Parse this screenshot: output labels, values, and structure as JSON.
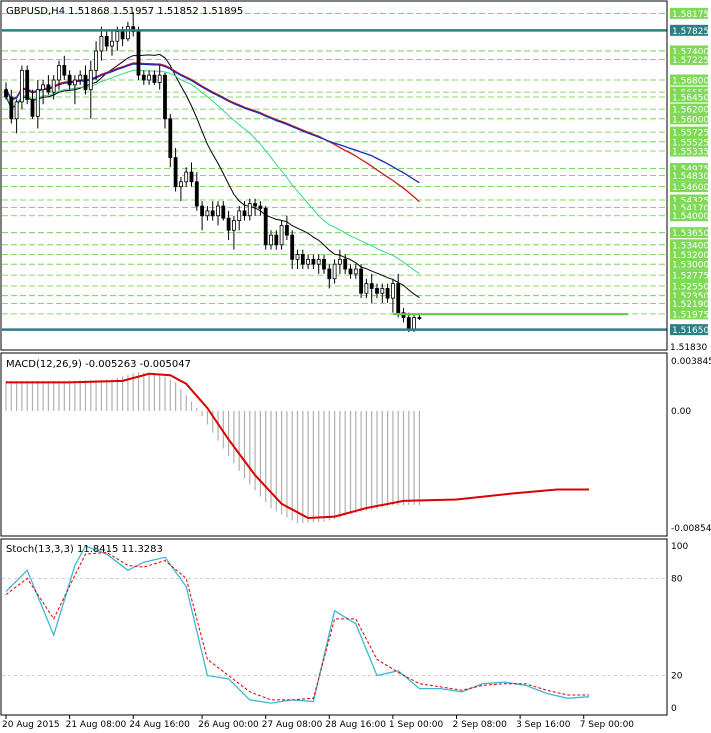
{
  "colors": {
    "background": "#ffffff",
    "frame": "#000000",
    "grid": "#c0c0c0",
    "bull_body": "#ffffff",
    "bear_body": "#000000",
    "candle_outline": "#000000",
    "support_line": "#2a7f85",
    "level_line": "#5ccc3a",
    "label_bg": "#7ed957",
    "ma_fast": "#000000",
    "ma_medium": "#39d883",
    "ma_slow_red": "#c81818",
    "ma_slow_blue": "#1a2ab8",
    "macd_hist": "#b0b0b0",
    "macd_signal": "#dd0000",
    "stoch_main": "#3fb6d8",
    "stoch_signal": "#dd0000"
  },
  "chart_data": [
    {
      "type": "candlestick",
      "title": "GBPUSD,H4",
      "ohlc_header": "1.51868 1.51957 1.51852 1.51895",
      "ylim": [
        1.5123,
        1.5843
      ],
      "y_ticks": [
        "1.58175",
        "1.57825",
        "1.57400",
        "1.57225",
        "1.56800",
        "1.56550",
        "1.56450",
        "1.56200",
        "1.56000",
        "1.55725",
        "1.55525",
        "1.55335",
        "1.54975",
        "1.54830",
        "1.54600",
        "1.54325",
        "1.54170",
        "1.54000",
        "1.53650",
        "1.53400",
        "1.53200",
        "1.53000",
        "1.52775",
        "1.52550",
        "1.52350",
        "1.52190",
        "1.51975",
        "1.51650"
      ],
      "levels_sorted": [
        1.58175,
        1.57825,
        1.574,
        1.57225,
        1.568,
        1.5655,
        1.5645,
        1.562,
        1.56,
        1.55725,
        1.55525,
        1.55335,
        1.54975,
        1.5483,
        1.546,
        1.54325,
        1.5417,
        1.54,
        1.5365,
        1.534,
        1.532,
        1.53,
        1.52775,
        1.5255,
        1.5235,
        1.5219,
        1.51975,
        1.5165
      ],
      "highlighted_levels": [
        "1.57825",
        "1.51650"
      ],
      "green_segment_level": 1.5197,
      "partial_tick_label": "1.51830",
      "x_labels": [
        "20 Aug 2015",
        "21 Aug 08:00",
        "24 Aug 16:00",
        "26 Aug 00:00",
        "27 Aug 08:00",
        "28 Aug 16:00",
        "1 Sep 00:00",
        "2 Sep 08:00",
        "3 Sep 16:00",
        "7 Sep 00:00"
      ],
      "candles": [
        [
          1.566,
          1.5675,
          1.564,
          1.5645
        ],
        [
          1.5645,
          1.566,
          1.559,
          1.56
        ],
        [
          1.56,
          1.564,
          1.557,
          1.5635
        ],
        [
          1.5635,
          1.571,
          1.562,
          1.57
        ],
        [
          1.57,
          1.571,
          1.563,
          1.564
        ],
        [
          1.564,
          1.566,
          1.56,
          1.5605
        ],
        [
          1.5605,
          1.568,
          1.558,
          1.566
        ],
        [
          1.566,
          1.568,
          1.563,
          1.567
        ],
        [
          1.567,
          1.569,
          1.565,
          1.5655
        ],
        [
          1.5655,
          1.569,
          1.564,
          1.568
        ],
        [
          1.568,
          1.572,
          1.566,
          1.571
        ],
        [
          1.571,
          1.573,
          1.568,
          1.569
        ],
        [
          1.569,
          1.57,
          1.566,
          1.567
        ],
        [
          1.567,
          1.569,
          1.563,
          1.568
        ],
        [
          1.568,
          1.57,
          1.567,
          1.569
        ],
        [
          1.569,
          1.571,
          1.565,
          1.566
        ],
        [
          1.566,
          1.572,
          1.56,
          1.57
        ],
        [
          1.57,
          1.576,
          1.568,
          1.574
        ],
        [
          1.574,
          1.579,
          1.572,
          1.577
        ],
        [
          1.577,
          1.578,
          1.574,
          1.575
        ],
        [
          1.575,
          1.578,
          1.573,
          1.576
        ],
        [
          1.576,
          1.579,
          1.574,
          1.578
        ],
        [
          1.578,
          1.579,
          1.575,
          1.5765
        ],
        [
          1.5765,
          1.58,
          1.576,
          1.579
        ],
        [
          1.579,
          1.582,
          1.577,
          1.578
        ],
        [
          1.578,
          1.579,
          1.568,
          1.569
        ],
        [
          1.569,
          1.57,
          1.567,
          1.568
        ],
        [
          1.568,
          1.57,
          1.567,
          1.569
        ],
        [
          1.569,
          1.57,
          1.567,
          1.5675
        ],
        [
          1.5675,
          1.571,
          1.566,
          1.569
        ],
        [
          1.569,
          1.5695,
          1.558,
          1.56
        ],
        [
          1.56,
          1.561,
          1.55,
          1.552
        ],
        [
          1.552,
          1.554,
          1.545,
          1.546
        ],
        [
          1.546,
          1.548,
          1.543,
          1.547
        ],
        [
          1.547,
          1.55,
          1.546,
          1.549
        ],
        [
          1.549,
          1.551,
          1.546,
          1.547
        ],
        [
          1.547,
          1.549,
          1.541,
          1.542
        ],
        [
          1.542,
          1.543,
          1.537,
          1.54
        ],
        [
          1.54,
          1.542,
          1.539,
          1.541
        ],
        [
          1.541,
          1.543,
          1.539,
          1.54
        ],
        [
          1.54,
          1.543,
          1.538,
          1.542
        ],
        [
          1.542,
          1.543,
          1.539,
          1.5395
        ],
        [
          1.5395,
          1.541,
          1.535,
          1.537
        ],
        [
          1.537,
          1.54,
          1.533,
          1.539
        ],
        [
          1.539,
          1.542,
          1.537,
          1.541
        ],
        [
          1.541,
          1.543,
          1.539,
          1.54
        ],
        [
          1.54,
          1.5435,
          1.539,
          1.5425
        ],
        [
          1.5425,
          1.5435,
          1.54,
          1.542
        ],
        [
          1.542,
          1.543,
          1.54,
          1.5415
        ],
        [
          1.5415,
          1.542,
          1.533,
          1.534
        ],
        [
          1.534,
          1.537,
          1.533,
          1.536
        ],
        [
          1.536,
          1.537,
          1.533,
          1.534
        ],
        [
          1.534,
          1.539,
          1.533,
          1.538
        ],
        [
          1.538,
          1.54,
          1.535,
          1.536
        ],
        [
          1.536,
          1.537,
          1.529,
          1.531
        ],
        [
          1.531,
          1.533,
          1.529,
          1.532
        ],
        [
          1.532,
          1.533,
          1.529,
          1.53
        ],
        [
          1.53,
          1.532,
          1.529,
          1.531
        ],
        [
          1.531,
          1.532,
          1.529,
          1.53
        ],
        [
          1.53,
          1.532,
          1.528,
          1.531
        ],
        [
          1.531,
          1.532,
          1.528,
          1.529
        ],
        [
          1.529,
          1.53,
          1.525,
          1.527
        ],
        [
          1.527,
          1.531,
          1.526,
          1.53
        ],
        [
          1.53,
          1.533,
          1.528,
          1.531
        ],
        [
          1.531,
          1.532,
          1.528,
          1.529
        ],
        [
          1.529,
          1.53,
          1.527,
          1.528
        ],
        [
          1.528,
          1.53,
          1.527,
          1.529
        ],
        [
          1.529,
          1.53,
          1.523,
          1.524
        ],
        [
          1.524,
          1.527,
          1.523,
          1.526
        ],
        [
          1.526,
          1.528,
          1.522,
          1.525
        ],
        [
          1.525,
          1.526,
          1.523,
          1.524
        ],
        [
          1.524,
          1.526,
          1.522,
          1.525
        ],
        [
          1.525,
          1.526,
          1.522,
          1.523
        ],
        [
          1.523,
          1.527,
          1.52,
          1.526
        ],
        [
          1.526,
          1.528,
          1.519,
          1.52
        ],
        [
          1.52,
          1.521,
          1.518,
          1.519
        ],
        [
          1.519,
          1.52,
          1.516,
          1.5165
        ],
        [
          1.5165,
          1.5195,
          1.516,
          1.519
        ],
        [
          1.519,
          1.5196,
          1.5185,
          1.51895
        ]
      ]
    },
    {
      "type": "histogram_line",
      "title": "MACD(12,26,9) -0.005263 -0.005047",
      "y_ticks": [
        "0.003845",
        "0.00",
        "-0.008547"
      ],
      "ylim": [
        -0.008547,
        0.003845
      ],
      "signal_points": [
        [
          0,
          0.002
        ],
        [
          12,
          0.002
        ],
        [
          22,
          0.0021
        ],
        [
          27,
          0.0026
        ],
        [
          31,
          0.0025
        ],
        [
          34,
          0.0019
        ],
        [
          38,
          0.0002
        ],
        [
          42,
          -0.002
        ],
        [
          47,
          -0.0045
        ],
        [
          52,
          -0.0065
        ],
        [
          57,
          -0.0075
        ],
        [
          62,
          -0.0074
        ],
        [
          68,
          -0.0068
        ],
        [
          75,
          -0.0063
        ],
        [
          85,
          -0.0062
        ],
        [
          95,
          -0.0058
        ],
        [
          104,
          -0.0055
        ],
        [
          110,
          -0.0055
        ]
      ]
    },
    {
      "type": "line",
      "title": "Stoch(13,3,3) 11.8415 11.3283",
      "y_ticks": [
        "100",
        "80",
        "20",
        "0"
      ],
      "ylim": [
        0,
        100
      ],
      "main_points": [
        [
          0,
          72
        ],
        [
          4,
          85
        ],
        [
          9,
          45
        ],
        [
          13,
          88
        ],
        [
          15,
          100
        ],
        [
          19,
          95
        ],
        [
          23,
          85
        ],
        [
          26,
          90
        ],
        [
          30,
          93
        ],
        [
          34,
          75
        ],
        [
          38,
          20
        ],
        [
          42,
          18
        ],
        [
          46,
          5
        ],
        [
          50,
          3
        ],
        [
          54,
          5
        ],
        [
          58,
          4
        ],
        [
          62,
          60
        ],
        [
          66,
          52
        ],
        [
          70,
          20
        ],
        [
          74,
          23
        ],
        [
          78,
          12
        ],
        [
          82,
          12
        ],
        [
          86,
          10
        ],
        [
          90,
          15
        ],
        [
          94,
          16
        ],
        [
          98,
          14
        ],
        [
          102,
          9
        ],
        [
          106,
          6
        ],
        [
          110,
          7
        ]
      ],
      "signal_points": [
        [
          0,
          70
        ],
        [
          4,
          80
        ],
        [
          9,
          55
        ],
        [
          13,
          82
        ],
        [
          15,
          95
        ],
        [
          19,
          96
        ],
        [
          23,
          88
        ],
        [
          26,
          87
        ],
        [
          30,
          91
        ],
        [
          34,
          80
        ],
        [
          38,
          30
        ],
        [
          42,
          20
        ],
        [
          46,
          10
        ],
        [
          50,
          5
        ],
        [
          54,
          5
        ],
        [
          58,
          6
        ],
        [
          62,
          55
        ],
        [
          66,
          55
        ],
        [
          70,
          30
        ],
        [
          74,
          22
        ],
        [
          78,
          15
        ],
        [
          82,
          13
        ],
        [
          86,
          11
        ],
        [
          90,
          14
        ],
        [
          94,
          15
        ],
        [
          98,
          15
        ],
        [
          102,
          11
        ],
        [
          106,
          8
        ],
        [
          110,
          8
        ]
      ]
    }
  ]
}
